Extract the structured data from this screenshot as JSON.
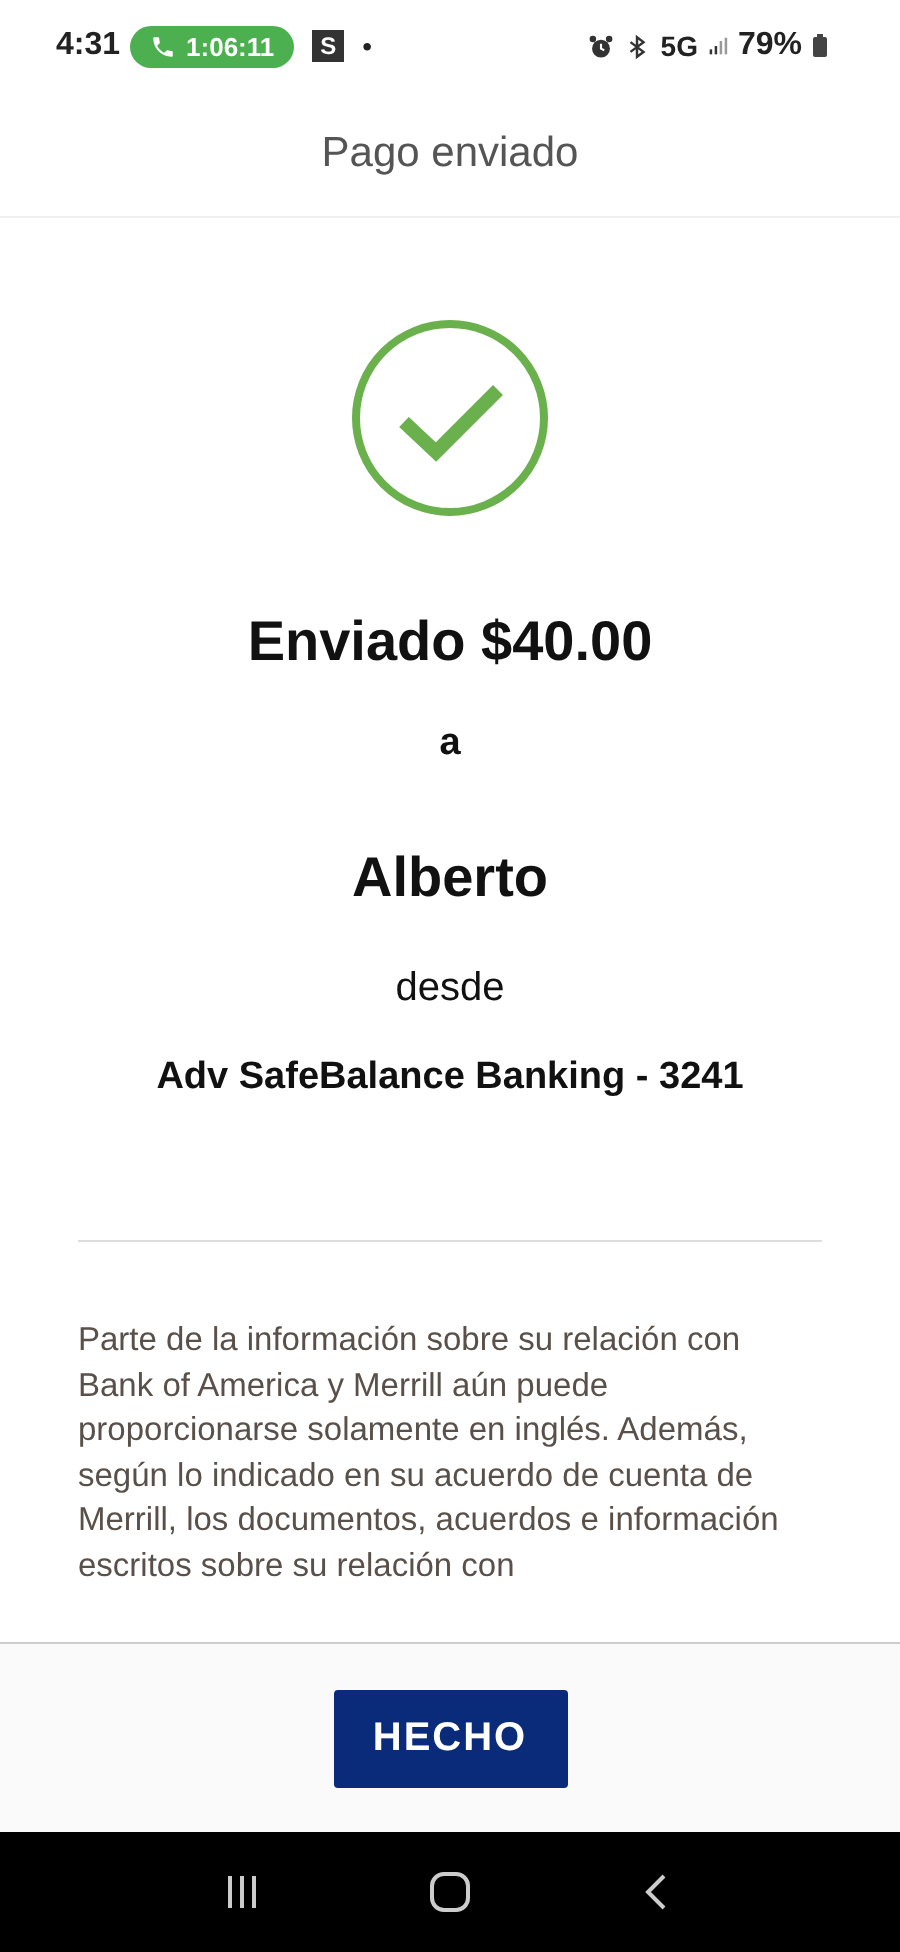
{
  "status_bar": {
    "time": "4:31",
    "call_timer": "1:06:11",
    "app_badge": "S",
    "dot": "•",
    "network": "5G",
    "battery": "79%"
  },
  "header": {
    "title": "Pago enviado"
  },
  "confirmation": {
    "amount_line": "Enviado $40.00",
    "to_word": "a",
    "recipient": "Alberto",
    "from_word": "desde",
    "account": "Adv SafeBalance Banking - 3241"
  },
  "disclaimer": "Parte de la información sobre su relación con Bank of America y Merrill aún puede proporcionarse solamente en inglés. Además, según lo indicado en su acuerdo de cuenta de Merrill, los documentos, acuerdos e información escritos sobre su relación con",
  "footer": {
    "button": "HECHO"
  }
}
